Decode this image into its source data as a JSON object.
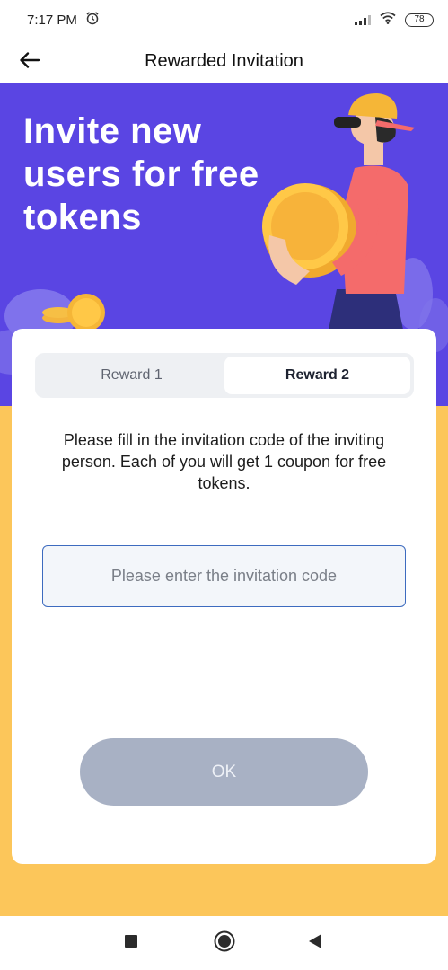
{
  "status_bar": {
    "time": "7:17 PM",
    "alarm_icon": "alarm-clock-icon",
    "signal_icon": "cellular-signal-icon",
    "wifi_icon": "wifi-icon",
    "battery_level": "78"
  },
  "app_bar": {
    "title": "Rewarded Invitation",
    "back_icon": "arrow-left-icon"
  },
  "hero": {
    "headline": "Invite new users for free tokens"
  },
  "tabs": [
    {
      "label": "Reward 1",
      "active": false
    },
    {
      "label": "Reward 2",
      "active": true
    }
  ],
  "form": {
    "description": "Please fill in the invitation code of the inviting person. Each of you will get 1 coupon for free tokens.",
    "input_placeholder": "Please enter the invitation code",
    "input_value": "",
    "submit_label": "OK"
  },
  "navigation": {
    "recents_icon": "square-icon",
    "home_icon": "circle-icon",
    "back_icon": "triangle-back-icon"
  },
  "colors": {
    "hero_background": "#5a45e3",
    "lower_background": "#fcc65a",
    "button_disabled": "#a8b1c4",
    "input_border": "#3d6bbf"
  }
}
